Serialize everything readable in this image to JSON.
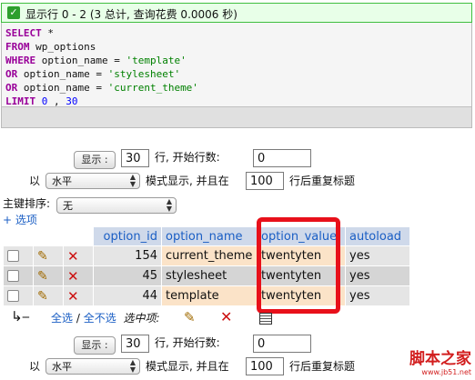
{
  "status": {
    "message": "显示行 0 - 2 (3 总计, 查询花费 0.0006 秒)"
  },
  "sql": {
    "l1_kw": "SELECT",
    "l1_rest": " *",
    "l2_kw": "FROM",
    "l2_rest": " wp_options",
    "l3_kw": "WHERE",
    "l3_rest": " option_name = ",
    "l3_str": "'template'",
    "l4_kw": "OR",
    "l4_rest": " option_name = ",
    "l4_str": "'stylesheet'",
    "l5_kw": "OR",
    "l5_rest": " option_name = ",
    "l5_str": "'current_theme'",
    "l6_kw": "LIMIT",
    "l6_num1": " 0",
    "l6_sep": " , ",
    "l6_num2": "30"
  },
  "nav_top": {
    "show_button": "显示 :",
    "rows_value": "30",
    "start_label": "行, 开始行数:",
    "start_value": "0",
    "with_label": "以",
    "mode_value": "水平",
    "mode_label": "模式显示, 并且在",
    "repeat_value": "100",
    "repeat_label": "行后重复标题"
  },
  "sort": {
    "label": "主键排序:",
    "value": "无"
  },
  "options_link": "+ 选项",
  "table": {
    "headers": [
      "option_id",
      "option_name",
      "option_value",
      "autoload"
    ],
    "rows": [
      {
        "id": "154",
        "name": "current_theme",
        "value": "twentyten",
        "autoload": "yes"
      },
      {
        "id": "45",
        "name": "stylesheet",
        "value": "twentyten",
        "autoload": "yes"
      },
      {
        "id": "44",
        "name": "template",
        "value": "twentyten",
        "autoload": "yes"
      }
    ]
  },
  "bulk": {
    "check_all": "全选",
    "sep": " / ",
    "uncheck_all": "全不选",
    "with_selected": "选中项:"
  },
  "nav_bottom": {
    "show_button": "显示 :",
    "rows_value": "30",
    "start_label": "行, 开始行数:",
    "start_value": "0",
    "with_label": "以",
    "mode_value": "水平",
    "mode_label": "模式显示, 并且在",
    "repeat_value": "100",
    "repeat_label": "行后重复标题"
  },
  "watermark": {
    "cn": "脚本之家",
    "url": "www.jb51.net"
  },
  "icons": {
    "pencil": "pencil-icon",
    "delete": "cross-icon",
    "export": "export-icon",
    "check": "check-icon",
    "arrow": "corner-arrow-icon"
  },
  "colors": {
    "status_border": "#3fbe3f",
    "status_bg": "#e8ffe8",
    "header_bg": "#cfd9ea",
    "link": "#1a5ec4",
    "highlight": "#e8101a",
    "row_hover": "#fbe3c8"
  }
}
